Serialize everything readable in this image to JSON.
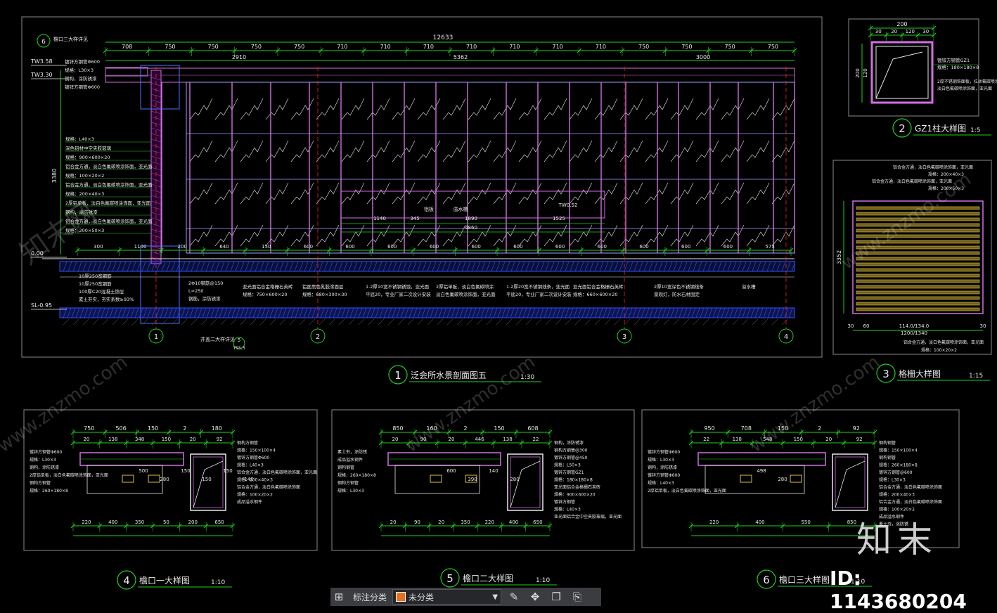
{
  "drawing": {
    "views": [
      {
        "num": "1",
        "title": "泛会所水景剖面图五",
        "scale": "1:30"
      },
      {
        "num": "2",
        "title": "GZ1柱大样图",
        "scale": "1:5"
      },
      {
        "num": "3",
        "title": "格栅大样图",
        "scale": "1:15"
      },
      {
        "num": "4",
        "title": "檐口一大样图",
        "scale": "1:10"
      },
      {
        "num": "5",
        "title": "檐口二大样图",
        "scale": "1:10"
      },
      {
        "num": "6",
        "title": "檐口三大样图",
        "scale": "1:10"
      }
    ],
    "section_dims_top": [
      "708",
      "750",
      "750",
      "750",
      "750",
      "710",
      "710",
      "710",
      "710",
      "710",
      "710",
      "710",
      "750",
      "750",
      "750",
      "750"
    ],
    "section_total_top": "12633",
    "section_sub_totals": [
      "2910",
      "5362",
      "3000"
    ],
    "section_dims_bottom": [
      "300",
      "1100",
      "200",
      "640",
      "150",
      "600",
      "600",
      "600",
      "600",
      "600",
      "600",
      "600",
      "600",
      "600",
      "600",
      "600",
      "573"
    ],
    "section_height": "3380",
    "elevations": [
      "TW3.58",
      "TW3.30",
      "0.00",
      "SL-0.95",
      "TW0.52"
    ],
    "axis_labels": [
      "1",
      "2",
      "3",
      "4"
    ],
    "detail_callout": "檐口三大样详见",
    "section_notes_left": [
      "镀锌方钢管Φ600",
      "规格：L30×3",
      "钢构，涂防锈漆",
      "镀锌方钢管Φ600",
      "规格：L40×3",
      "深色铝材中空夹胶玻璃",
      "规格：900×600×20",
      "铝合金方通，淡白色氟碳喷涂饰面，亚光面",
      "规格：100×20×2",
      "铝合金方通，淡白色氟碳喷涂饰面，亚光面",
      "规格：200×40×3",
      "2厚铝单板，淡白色氟碳喷涂饰面，亚光面",
      "钢构，涂防锈漆",
      "铝合金方通，淡白色氟碳喷涂饰面，亚光面",
      "规格：200×50×3"
    ],
    "section_notes_bottom": [
      "亚光面铝合金格栅石英砖",
      "规格：750×600×20",
      "铝面黑色乳胶漆面层",
      "规格：680×300×30",
      "1.2厚10宽不锈钢锈蚀，亚光面",
      "平底20，专业厂家二次设计安装",
      "2厚铝单板，淡白色氟碳喷涂",
      "淡白色氟碳喷涂饰面，亚光面",
      "1.2厚20宽不锈钢线条，亚光面",
      "平底20，专业厂家二次设计安装",
      "亚光面铝合金格栅石英砖",
      "规格：660×600×20",
      "2厚10宽深色不锈钢线条",
      "景观灯，防水石材固定",
      "溢水槽"
    ],
    "foundation_notes": [
      "10厚250宽钢筋",
      "10厚250宽钢筋",
      "100厚C20混凝土垫层",
      "素土夯实，夯实系数≥93%",
      "2Φ10钢筋@150",
      "L=250",
      "钢筋，涂防锈漆"
    ],
    "section_misc": [
      "1890",
      "1880",
      "1525",
      "4860",
      "1140",
      "345",
      "溢水槽",
      "铝板",
      "井盖二大样详见",
      "5",
      "YS5.3"
    ],
    "gz1": {
      "dims": [
        "200",
        "30",
        "20",
        "120",
        "30",
        "8",
        "200",
        "20",
        "30",
        "120"
      ],
      "notes": [
        "镀锌方钢管GZ1",
        "规格：180×180×8",
        "2厚不锈钢饰面板，拉丝氟碳喷涂",
        "淡白色氟碳喷涂饰面，亚光面"
      ]
    },
    "grille": {
      "dims": [
        "3352",
        "30",
        "60",
        "114.0/134.0",
        "1200/1340",
        "30"
      ],
      "notes": [
        "铝合金方通，淡白色氟碳喷涂饰面，亚光面",
        "规格：200×40×3",
        "铝合金方通，淡白色氟碳喷涂饰面，亚光面",
        "规格：100×20×2",
        "铝合金方通，淡白色氟碳喷涂饰面，亚光面",
        "规格：200×50×3"
      ]
    },
    "detail4": {
      "dims_top": [
        "750",
        "506",
        "150",
        "2",
        "180",
        "20",
        "138",
        "348",
        "150",
        "20",
        "92"
      ],
      "dims_bottom": [
        "220",
        "400",
        "350",
        "50",
        "200",
        "650"
      ],
      "inner": [
        "500",
        "280",
        "150",
        "150",
        "150",
        "140"
      ],
      "notes": [
        "镀锌方钢管Φ600",
        "规格：L30×3",
        "钢构，涂防锈漆",
        "2厚铝单板，淡白色氟碳喷涂饰面，亚光面",
        "钢构方钢管",
        "规格：260×180×8",
        "钢构方钢管",
        "规格：150×100×4",
        "镀锌方钢管Φ600",
        "规格：L40×3",
        "铝合金方通，淡白色氟碳喷涂饰面，亚光面",
        "规格：200×40×3",
        "铝合金方通，淡白色氟碳喷涂饰面",
        "规格：100×20×2",
        "成品溢水钢件"
      ]
    },
    "detail5": {
      "dims_top": [
        "850",
        "160",
        "2",
        "150",
        "608",
        "20",
        "90",
        "20",
        "446",
        "138",
        "22"
      ],
      "dims_bottom": [
        "20",
        "90",
        "20",
        "350",
        "220",
        "400",
        "650"
      ],
      "inner": [
        "600",
        "398",
        "140",
        "280"
      ],
      "notes": [
        "素土夯，涂防锈",
        "成品溢水钢件",
        "钢构钢管",
        "规格：260×180×8",
        "钢构方钢管",
        "规格：L30×3",
        "钢构，涂防锈漆",
        "钢构方钢管@300",
        "镀锌方钢管@450",
        "规格：L50×3",
        "镀锌方钢管GZ1",
        "规格：180×180×8",
        "亚光面铝合金格栅石英砖",
        "规格：900×600×20",
        "镀锌方钢管",
        "规格：L40×3",
        "亚光面铝合金中空夹胶玻璃，亚光面"
      ]
    },
    "detail6": {
      "dims_top": [
        "950",
        "708",
        "150",
        "2",
        "92",
        "22",
        "138",
        "548",
        "150",
        "20",
        "92"
      ],
      "dims_bottom": [
        "220",
        "400",
        "550",
        "850"
      ],
      "inner": [
        "498",
        "280"
      ],
      "notes": [
        "镀锌方钢管Φ600",
        "规格：L30×3",
        "钢构，涂防锈漆",
        "镀锌方钢管Φ600",
        "规格：L40×3",
        "2厚铝单板，淡白色氟碳喷涂饰面，亚光面",
        "钢构钢管",
        "规格：150×100×4",
        "钢构钢管",
        "规格：260×180×8",
        "镀锌方钢管@600",
        "规格：L30×3",
        "铝合金方通，淡白色氟碳喷涂饰面",
        "规格：200×40×3",
        "铝合金方通，淡白色氟碳喷涂饰面",
        "规格：100×20×2",
        "成品溢水钢件",
        "素土夯，涂防锈"
      ]
    }
  },
  "watermarks": [
    "知末网",
    "www.znzmo.com",
    "www.znzmo.com",
    "www.znzmo.com",
    "www.znzmo.com"
  ],
  "brand": {
    "logo": "知末",
    "id": "ID: 1143680204"
  },
  "toolbar": {
    "label": "标注分类",
    "selected": "未分类",
    "swatch_color": "#e8701f"
  },
  "colors": {
    "dim": "#20d020",
    "note": "#e8e8e8",
    "structure": "#d070e0",
    "glass": "#a0a0ff",
    "ground": "#3050ff",
    "axis": "#ff2020",
    "frame": "#8a8a8a"
  }
}
